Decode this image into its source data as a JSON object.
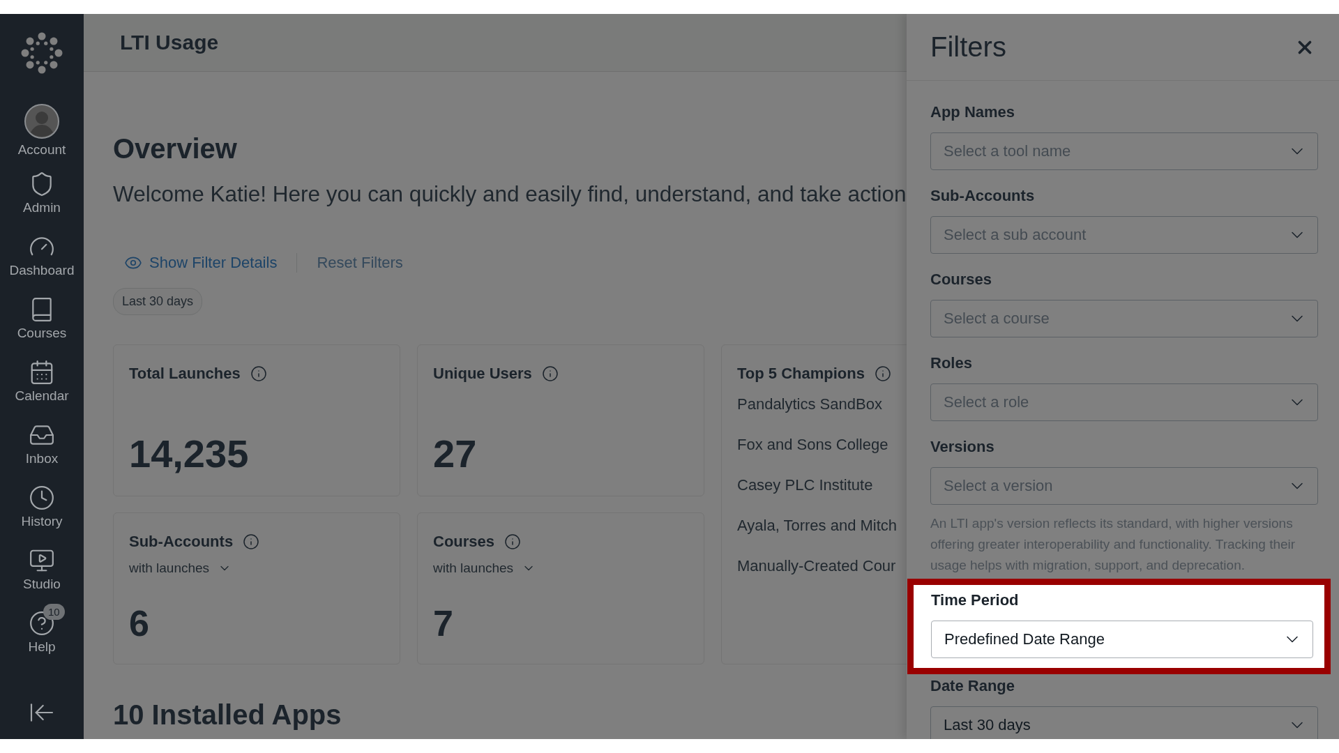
{
  "sidebar": {
    "items": [
      {
        "label": "Account",
        "kind": "avatar",
        "selected": false
      },
      {
        "label": "Admin",
        "kind": "shield",
        "selected": false
      },
      {
        "label": "Dashboard",
        "kind": "gauge",
        "selected": false
      },
      {
        "label": "Courses",
        "kind": "book",
        "selected": false
      },
      {
        "label": "Calendar",
        "kind": "calendar",
        "selected": false
      },
      {
        "label": "Inbox",
        "kind": "inbox",
        "selected": false
      },
      {
        "label": "History",
        "kind": "clock",
        "selected": false
      },
      {
        "label": "Studio",
        "kind": "studio",
        "selected": false
      },
      {
        "label": "Help",
        "kind": "help",
        "selected": false,
        "badge": "10"
      }
    ]
  },
  "header": {
    "title": "LTI Usage"
  },
  "overview": {
    "title": "Overview",
    "welcome": "Welcome Katie! Here you can quickly and easily find, understand, and take action",
    "show_filter_details": "Show Filter Details",
    "reset_filters": "Reset Filters",
    "active_filter": "Last 30 days"
  },
  "cards": [
    {
      "kind": "stat",
      "title": "Total Launches",
      "value": "14,235"
    },
    {
      "kind": "stat",
      "title": "Unique Users",
      "value": "27"
    },
    {
      "kind": "list",
      "title": "Top 5 Champions",
      "items": [
        "Pandalytics SandBox",
        "Fox and Sons College",
        "Casey PLC Institute",
        "Ayala, Torres and Mitch",
        "Manually-Created Cour"
      ]
    },
    {
      "kind": "stat",
      "title": "Sub-Accounts",
      "dropdown": "with launches",
      "value": "6"
    },
    {
      "kind": "stat",
      "title": "Courses",
      "dropdown": "with launches",
      "value": "7"
    }
  ],
  "installed_apps": {
    "title": "10 Installed Apps"
  },
  "filters": {
    "title": "Filters",
    "fields": [
      {
        "label": "App Names",
        "placeholder": "Select a tool name",
        "highlighted": false
      },
      {
        "label": "Sub-Accounts",
        "placeholder": "Select a sub account",
        "highlighted": false
      },
      {
        "label": "Courses",
        "placeholder": "Select a course",
        "highlighted": false
      },
      {
        "label": "Roles",
        "placeholder": "Select a role",
        "highlighted": false
      },
      {
        "label": "Versions",
        "placeholder": "Select a version",
        "highlighted": false,
        "note": "An LTI app's version reflects its standard, with higher versions offering greater interoperability and functionality. Tracking their usage helps with migration, support, and deprecation."
      },
      {
        "label": "Time Period",
        "value": "Predefined Date Range",
        "highlighted": true
      },
      {
        "label": "Date Range",
        "value": "Last 30 days",
        "highlighted": false
      }
    ]
  }
}
